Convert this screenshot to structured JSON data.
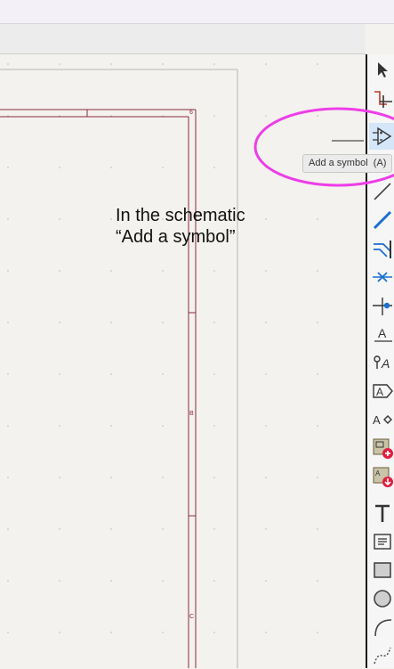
{
  "tooltip": {
    "label": "Add a symbol",
    "shortcut": "(A)"
  },
  "annotation": {
    "line1": "In the schematic",
    "line2": "“Add a symbol”"
  },
  "border_markers": {
    "top": "6",
    "side_b": "B",
    "side_c": "C"
  },
  "colors": {
    "sheet_border": "#8a2a3a",
    "highlight_ellipse": "#ee3de8",
    "tool_blue": "#1a6fd1",
    "tool_red": "#e01e3c"
  },
  "tools": [
    {
      "name": "select-arrow-icon"
    },
    {
      "name": "highlight-net-icon"
    },
    {
      "name": "add-symbol-icon",
      "active": true
    },
    {
      "name": "add-power-icon"
    },
    {
      "name": "draw-line-icon"
    },
    {
      "name": "add-wire-icon"
    },
    {
      "name": "add-bus-entry-icon"
    },
    {
      "name": "no-connect-icon"
    },
    {
      "name": "junction-icon"
    },
    {
      "name": "net-label-icon"
    },
    {
      "name": "global-label-icon"
    },
    {
      "name": "hierarchical-label-icon"
    },
    {
      "name": "hierarchical-pin-icon"
    },
    {
      "name": "add-sheet-icon"
    },
    {
      "name": "import-sheet-pin-icon"
    },
    {
      "name": "add-text-icon"
    },
    {
      "name": "add-textbox-icon"
    },
    {
      "name": "add-rectangle-icon"
    },
    {
      "name": "add-circle-icon"
    },
    {
      "name": "add-arc-icon"
    },
    {
      "name": "add-bezier-icon"
    }
  ]
}
